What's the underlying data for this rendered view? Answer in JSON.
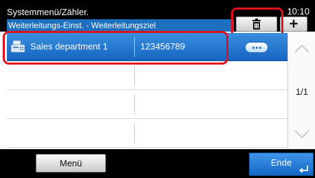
{
  "header": {
    "title_line1": "Systemmenü/Zähler.",
    "title_line2": "Weiterleitungs-Einst. - Weiterleitungsziel",
    "time": "10:10",
    "plus_label": "+"
  },
  "list": {
    "rows": [
      {
        "name": "Sales department 1",
        "number": "123456789",
        "selected": true,
        "icon": "fax-machine-icon"
      },
      {
        "name": "",
        "number": "",
        "selected": false
      },
      {
        "name": "",
        "number": "",
        "selected": false
      },
      {
        "name": "",
        "number": "",
        "selected": false
      }
    ]
  },
  "pagination": {
    "indicator": "1/1"
  },
  "footer": {
    "menu_label": "Menü",
    "end_label": "Ende"
  },
  "colors": {
    "selected_row": "#1f6fbf",
    "highlight": "#e3101b",
    "header_bg": "#000000"
  }
}
